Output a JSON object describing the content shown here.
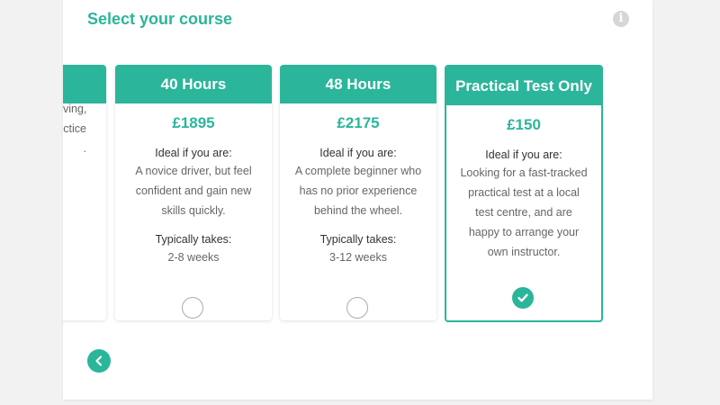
{
  "header": {
    "title": "Select your course"
  },
  "partial_card": {
    "lines": [
      "ving,",
      "ctice",
      "."
    ]
  },
  "cards": [
    {
      "title": "40 Hours",
      "price": "£1895",
      "ideal_label": "Ideal if you are:",
      "description": "A novice driver, but feel confident and gain new skills quickly.",
      "takes_label": "Typically takes:",
      "takes_value": "2-8 weeks",
      "selected": false
    },
    {
      "title": "48 Hours",
      "price": "£2175",
      "ideal_label": "Ideal if you are:",
      "description": "A complete beginner who has no prior experience behind the wheel.",
      "takes_label": "Typically takes:",
      "takes_value": "3-12 weeks",
      "selected": false
    },
    {
      "title": "Practical Test Only",
      "price": "£150",
      "ideal_label": "Ideal if you are:",
      "description": "Looking for a fast-tracked practical test at a local test centre, and are happy to arrange your own instructor.",
      "selected": true
    }
  ],
  "icons": {
    "info": "info-icon",
    "back": "chevron-left-icon",
    "check": "check-icon"
  },
  "colors": {
    "accent": "#2bb59a",
    "background": "#f2f2f2"
  }
}
